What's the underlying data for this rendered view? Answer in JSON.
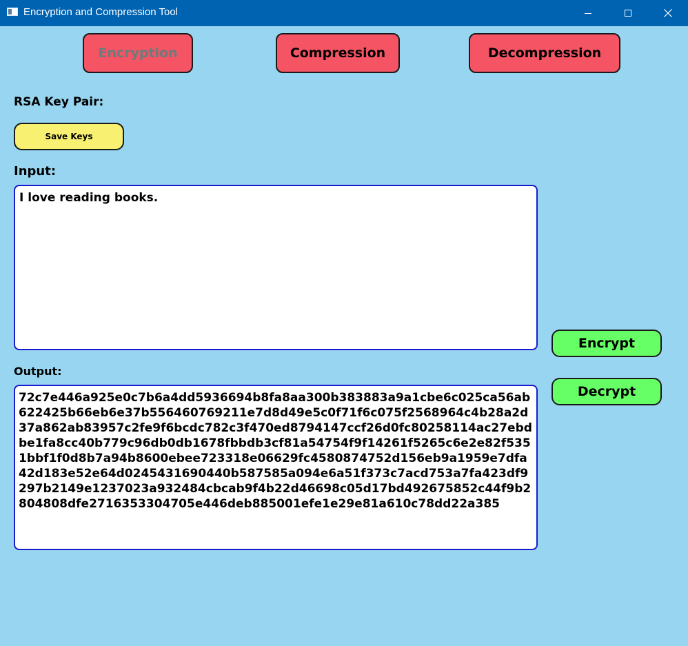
{
  "window": {
    "title": "Encryption and Compression Tool"
  },
  "tabs": {
    "encryption": "Encryption",
    "compression": "Compression",
    "decompression": "Decompression"
  },
  "keys": {
    "label": "RSA Key Pair:",
    "save_button": "Save Keys"
  },
  "input": {
    "label": "Input:",
    "value": "I love reading books."
  },
  "output": {
    "label": "Output:",
    "value": "72c7e446a925e0c7b6a4dd5936694b8fa8aa300b383883a9a1cbe6c025ca56ab622425b66eb6e37b556460769211e7d8d49e5c0f71f6c075f2568964c4b28a2d37a862ab83957c2fe9f6bcdc782c3f470ed8794147ccf26d0fc80258114ac27ebdbe1fa8cc40b779c96db0db1678fbbdb3cf81a54754f9f14261f5265c6e2e82f5351bbf1f0d8b7a94b8600ebee723318e06629fc4580874752d156eb9a1959e7dfa42d183e52e64d0245431690440b587585a094e6a51f373c7acd753a7fa423df9297b2149e1237023a932484cbcab9f4b22d46698c05d17bd492675852c44f9b2804808dfe2716353304705e446deb885001efe1e29e81a610c78dd22a385"
  },
  "actions": {
    "encrypt": "Encrypt",
    "decrypt": "Decrypt"
  },
  "colors": {
    "background": "#98d5f0",
    "titlebar": "#0063b1",
    "tab_button": "#f45464",
    "save_button": "#f7f070",
    "action_button": "#66ff66",
    "textbox_border": "#1a1ad0",
    "disabled_text": "#6b7c7c"
  },
  "icons": {
    "app": "app-window-icon",
    "minimize": "minimize-icon",
    "maximize": "maximize-icon",
    "close": "close-icon"
  }
}
